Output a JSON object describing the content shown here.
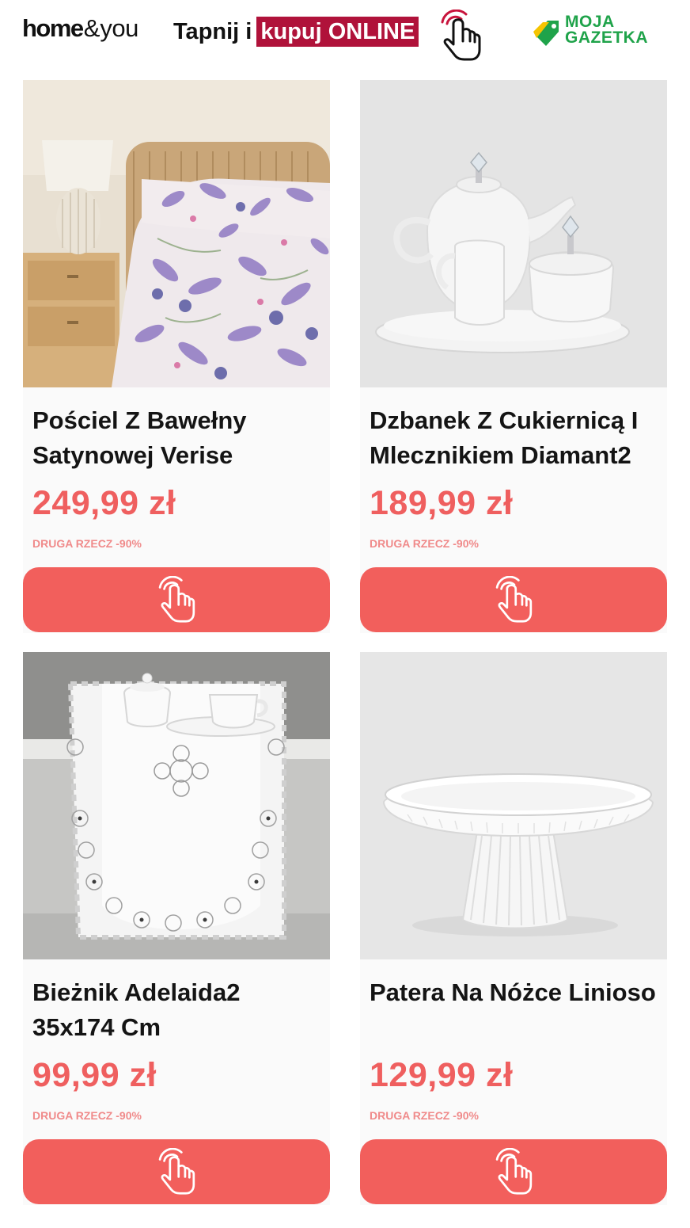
{
  "header": {
    "brand_home": "home",
    "brand_amp": "&",
    "brand_you": "you",
    "tagline_plain": "Tapnij i",
    "tagline_highlight": "kupuj ONLINE",
    "partner_line1": "MOJA",
    "partner_line2": "GAZETKA",
    "hand_icon": "tap-hand-icon",
    "highlight_color": "#b0123a",
    "partner_color": "#1fa34a"
  },
  "products": [
    {
      "name": "Pościel Z Bawełny Satynowej Verise",
      "price": "249,99 zł",
      "promo": "DRUGA RZECZ -90%",
      "image": "floral-bedding-photo"
    },
    {
      "name": "Dzbanek Z Cukiernicą I Mlecznikiem Diamant2",
      "price": "189,99 zł",
      "promo": "DRUGA RZECZ -90%",
      "image": "white-teapot-set-photo"
    },
    {
      "name": "Bieżnik Adelaida2 35x174 Cm",
      "price": "99,99 zł",
      "promo": "DRUGA RZECZ -90%",
      "image": "lace-table-runner-photo"
    },
    {
      "name": "Patera Na Nóżce Linioso",
      "price": "129,99 zł",
      "promo": "DRUGA RZECZ -90%",
      "image": "white-cake-stand-photo"
    }
  ],
  "colors": {
    "price": "#ef5f5f",
    "button": "#f25f5c",
    "promo": "#f08a8a"
  }
}
